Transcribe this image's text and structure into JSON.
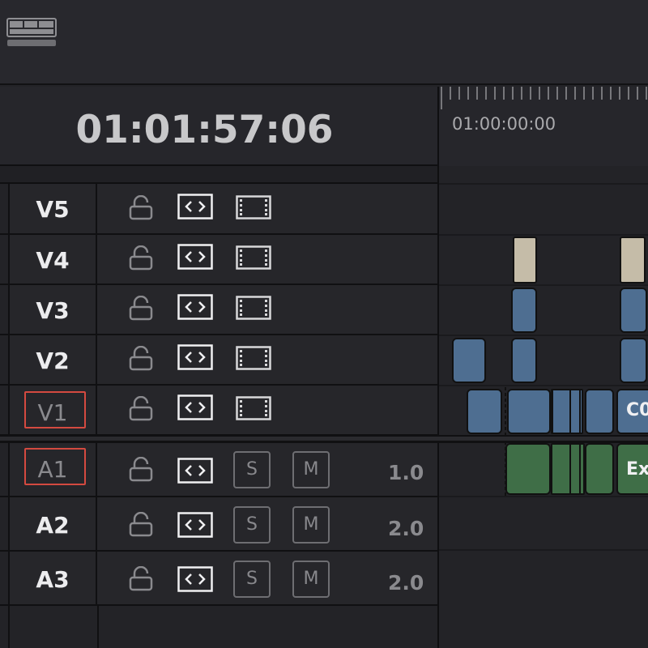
{
  "timecode": "01:01:57:06",
  "ruler": {
    "start_label": "01:00:00:00"
  },
  "video_tracks": [
    {
      "name": "V5"
    },
    {
      "name": "V4"
    },
    {
      "name": "V3"
    },
    {
      "name": "V2"
    },
    {
      "name": "V1",
      "selected": true
    }
  ],
  "audio_tracks": [
    {
      "name": "A1",
      "selected": true,
      "solo_label": "S",
      "mute_label": "M",
      "level": "1.0"
    },
    {
      "name": "A2",
      "solo_label": "S",
      "mute_label": "M",
      "level": "2.0"
    },
    {
      "name": "A3",
      "solo_label": "S",
      "mute_label": "M",
      "level": "2.0"
    }
  ],
  "clips": {
    "v1_label": "C0",
    "a1_label": "Ex"
  },
  "colors": {
    "video_clip": "#4e6e91",
    "title_clip": "#c5bca8",
    "audio_clip": "#3f6e47",
    "selection": "#d44a40"
  }
}
